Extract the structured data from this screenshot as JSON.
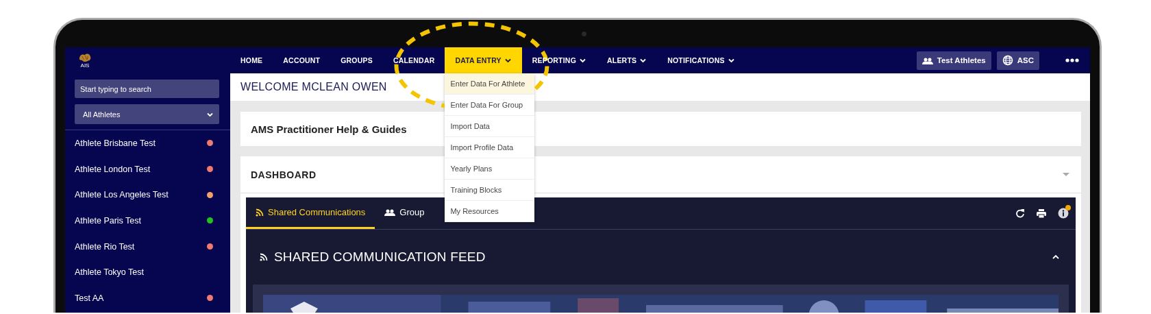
{
  "logo": {
    "label": "AIS"
  },
  "nav": {
    "items": [
      {
        "label": "HOME",
        "dropdown": false,
        "selected": false
      },
      {
        "label": "ACCOUNT",
        "dropdown": false,
        "selected": false
      },
      {
        "label": "GROUPS",
        "dropdown": false,
        "selected": false
      },
      {
        "label": "CALENDAR",
        "dropdown": false,
        "selected": false
      },
      {
        "label": "DATA ENTRY",
        "dropdown": true,
        "selected": true
      },
      {
        "label": "REPORTING",
        "dropdown": true,
        "selected": false
      },
      {
        "label": "ALERTS",
        "dropdown": true,
        "selected": false
      },
      {
        "label": "NOTIFICATIONS",
        "dropdown": true,
        "selected": false
      }
    ],
    "buttons": [
      {
        "label": "Test Athletes",
        "kind": "group"
      },
      {
        "label": "ASC",
        "kind": "globe"
      }
    ]
  },
  "dropdown_menu": {
    "items": [
      {
        "label": "Enter Data For Athlete",
        "selected": true
      },
      {
        "label": "Enter Data For Group",
        "selected": false
      },
      {
        "label": "Import Data",
        "selected": false
      },
      {
        "label": "Import Profile Data",
        "selected": false
      },
      {
        "label": "Yearly Plans",
        "selected": false
      },
      {
        "label": "Training Blocks",
        "selected": false
      },
      {
        "label": "My Resources",
        "selected": false
      }
    ]
  },
  "sidebar": {
    "search": {
      "placeholder": "Start typing to search"
    },
    "filter": {
      "value": "All Athletes"
    },
    "items": [
      {
        "name": "Athlete Brisbane Test",
        "color": "#f07a6e"
      },
      {
        "name": "Athlete London Test",
        "color": "#f07a6e"
      },
      {
        "name": "Athlete Los Angeles Test",
        "color": "#f2a06a"
      },
      {
        "name": "Athlete Paris Test",
        "color": "#1fc21f"
      },
      {
        "name": "Athlete Rio Test",
        "color": "#f07a6e"
      },
      {
        "name": "Athlete Tokyo Test"
      },
      {
        "name": "Test AA",
        "color": "#f07a6e"
      }
    ]
  },
  "welcome": "WELCOME MCLEAN OWEN",
  "help_card": {
    "title": "AMS Practitioner Help & Guides"
  },
  "dashboard": {
    "title": "DASHBOARD",
    "tabs": [
      {
        "label": "Shared Communications",
        "kind": "rss",
        "selected": true
      },
      {
        "label": "Group",
        "kind": "group",
        "selected": false
      }
    ],
    "info_notification": true,
    "feed": {
      "title": "SHARED COMMUNICATION FEED",
      "expanded": true
    }
  }
}
